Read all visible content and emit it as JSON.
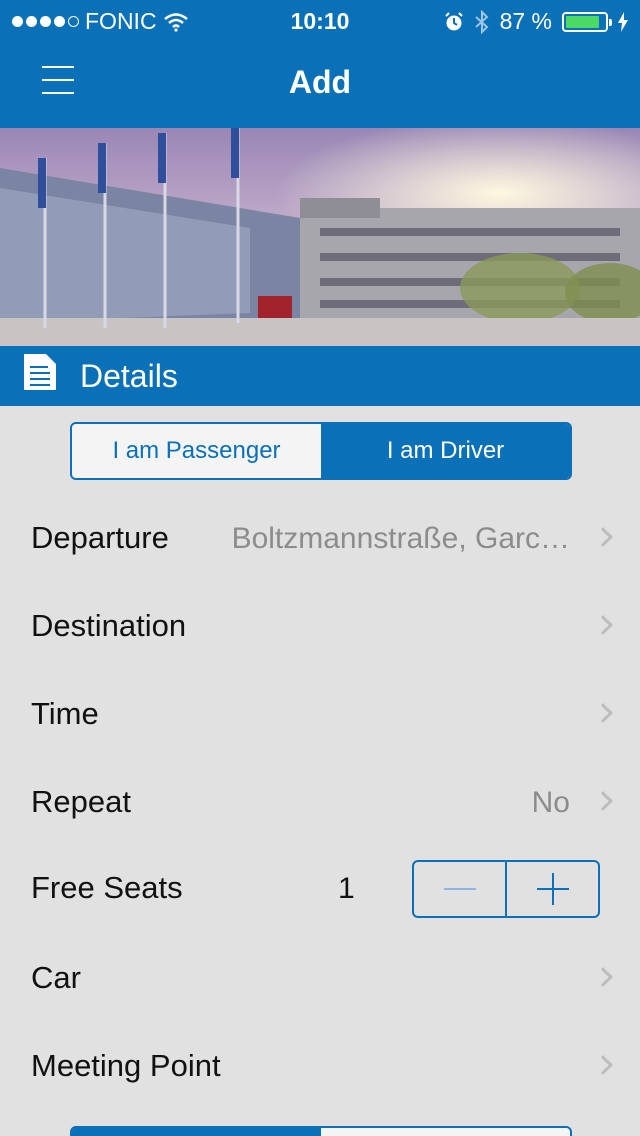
{
  "status_bar": {
    "carrier": "FONIC",
    "time": "10:10",
    "battery_text": "87 %",
    "battery_level": 0.87,
    "icons": [
      "signal-dots-icon",
      "wifi-icon",
      "alarm-icon",
      "bluetooth-icon",
      "battery-icon",
      "charging-icon"
    ]
  },
  "nav": {
    "title": "Add",
    "menu_icon": "hamburger-menu-icon"
  },
  "section": {
    "title": "Details",
    "icon": "document-icon"
  },
  "role_toggle": {
    "options": [
      "I am Passenger",
      "I am Driver"
    ],
    "selected": "I am Driver"
  },
  "form": {
    "departure": {
      "label": "Departure",
      "value": "Boltzmannstraße, Garc…"
    },
    "destination": {
      "label": "Destination",
      "value": ""
    },
    "time": {
      "label": "Time",
      "value": ""
    },
    "repeat": {
      "label": "Repeat",
      "value": "No"
    },
    "free_seats": {
      "label": "Free Seats",
      "value": "1"
    },
    "car": {
      "label": "Car",
      "value": ""
    },
    "meeting_point": {
      "label": "Meeting Point",
      "value": ""
    }
  },
  "colors": {
    "accent": "#0a70b8",
    "background": "#e1e1e1",
    "battery": "#4cd964"
  }
}
